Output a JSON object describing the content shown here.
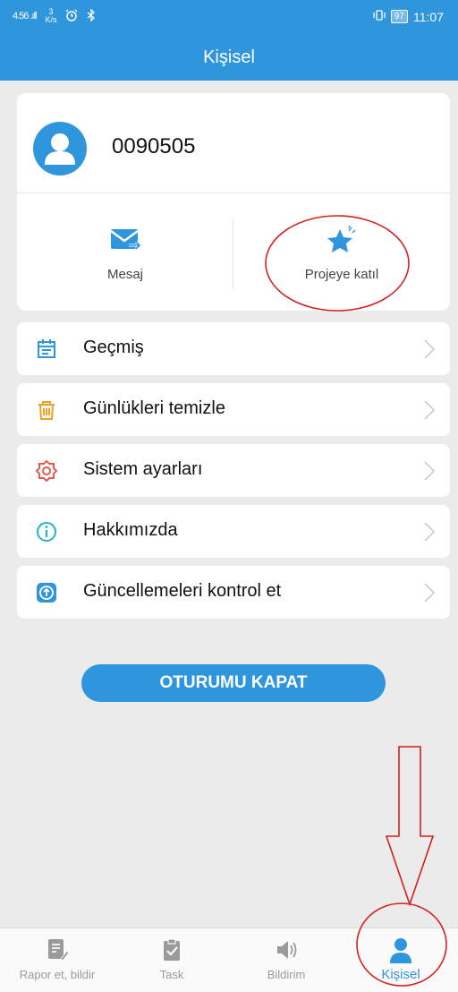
{
  "status_bar": {
    "signal": "4.56 .ıll",
    "speed_value": "3",
    "speed_unit": "K/s",
    "icons": [
      "alarm-icon",
      "bluetooth-icon",
      "vibrate-icon"
    ],
    "battery": "97",
    "time": "11:07"
  },
  "header": {
    "title": "Kişisel"
  },
  "profile": {
    "phone": "0090505"
  },
  "actions": [
    {
      "label": "Mesaj",
      "icon": "mail-icon"
    },
    {
      "label": "Projeye katıl",
      "icon": "star-icon"
    }
  ],
  "menu": [
    {
      "label": "Geçmiş",
      "icon": "calendar-icon",
      "color": "#2f95dd"
    },
    {
      "label": "Günlükleri temizle",
      "icon": "trash-icon",
      "color": "#f0a020"
    },
    {
      "label": "Sistem ayarları",
      "icon": "gear-icon",
      "color": "#e85a4f"
    },
    {
      "label": "Hakkımızda",
      "icon": "info-icon",
      "color": "#1fb6c9"
    },
    {
      "label": "Güncellemeleri kontrol et",
      "icon": "update-icon",
      "color": "#2f95dd"
    }
  ],
  "logout": {
    "label": "OTURUMU KAPAT"
  },
  "tabs": [
    {
      "label": "Rapor et, bildir",
      "icon": "report-icon"
    },
    {
      "label": "Task",
      "icon": "clipboard-icon"
    },
    {
      "label": "Bildirim",
      "icon": "speaker-icon"
    },
    {
      "label": "Kişisel",
      "icon": "person-icon",
      "active": true
    }
  ],
  "colors": {
    "primary": "#2f95dd",
    "background": "#ebebeb",
    "annotation": "#d62020"
  }
}
